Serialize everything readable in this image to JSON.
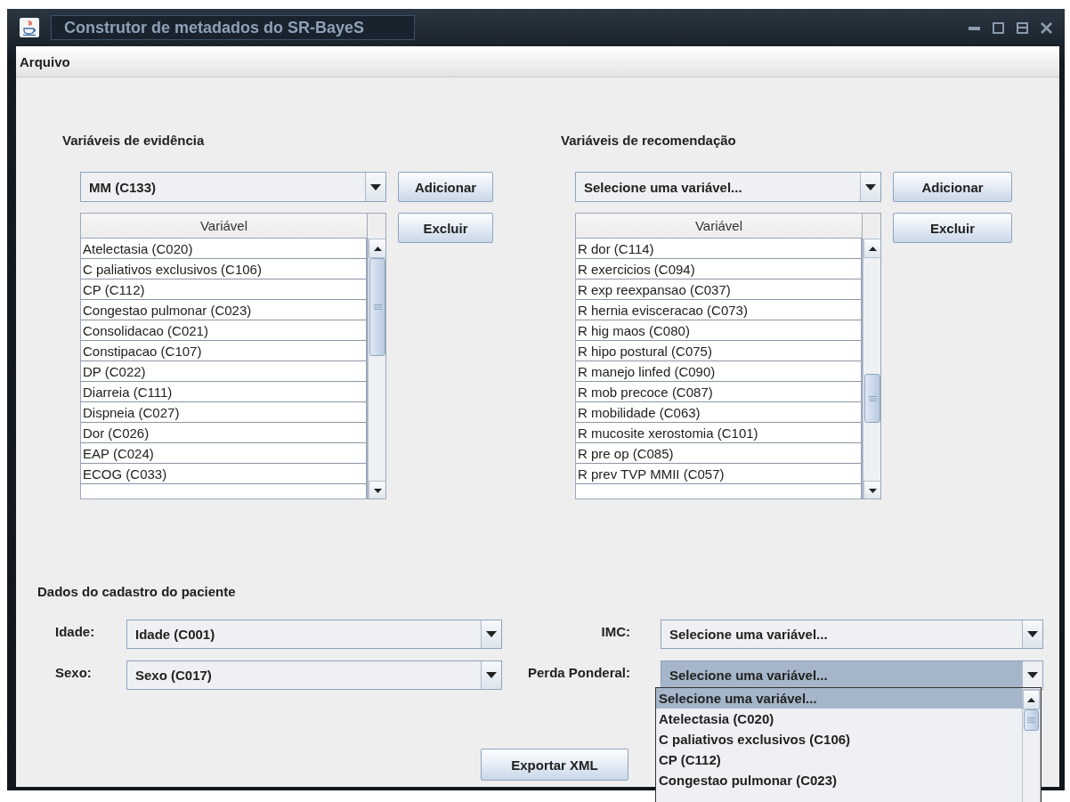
{
  "window": {
    "title": "Construtor de metadados do SR-BayeS"
  },
  "menu": [
    "Arquivo"
  ],
  "panels": [
    {
      "label": "Variáveis de evidência",
      "combo": "MM (C133)",
      "add_button": "Adicionar",
      "remove_button": "Excluir",
      "table": {
        "columns": [
          "Variável"
        ],
        "rows": [
          "Atelectasia (C020)",
          "C paliativos exclusivos (C106)",
          "CP (C112)",
          "Congestao pulmonar (C023)",
          "Consolidacao (C021)",
          "Constipacao (C107)",
          "DP (C022)",
          "Diarreia (C111)",
          "Dispneia (C027)",
          "Dor (C026)",
          "EAP (C024)",
          "ECOG (C033)"
        ]
      }
    },
    {
      "label": "Variáveis de recomendação",
      "combo": "Selecione uma variável...",
      "add_button": "Adicionar",
      "remove_button": "Excluir",
      "table": {
        "columns": [
          "Variável"
        ],
        "rows": [
          "R dor (C114)",
          "R exercicios (C094)",
          "R exp reexpansao (C037)",
          "R hernia evisceracao (C073)",
          "R hig maos (C080)",
          "R hipo postural (C075)",
          "R manejo linfed (C090)",
          "R mob precoce (C087)",
          "R mobilidade (C063)",
          "R mucosite xerostomia (C101)",
          "R pre op (C085)",
          "R prev TVP MMII (C057)"
        ]
      }
    }
  ],
  "patient": {
    "label": "Dados do cadastro do paciente",
    "fields": [
      {
        "label": "Idade:",
        "value": "Idade (C001)",
        "focused": false
      },
      {
        "label": "IMC:",
        "value": "Selecione uma variável...",
        "focused": false
      },
      {
        "label": "Sexo:",
        "value": "Sexo (C017)",
        "focused": false
      },
      {
        "label": "Perda Ponderal:",
        "value": "Selecione uma variável...",
        "focused": true
      }
    ]
  },
  "export_button": "Exportar XML",
  "popup": {
    "items": [
      {
        "label": "Selecione uma variável...",
        "selected": true
      },
      {
        "label": "Atelectasia (C020)",
        "selected": false
      },
      {
        "label": "C paliativos exclusivos (C106)",
        "selected": false
      },
      {
        "label": "CP (C112)",
        "selected": false
      },
      {
        "label": "Congestao pulmonar (C023)",
        "selected": false
      }
    ]
  }
}
